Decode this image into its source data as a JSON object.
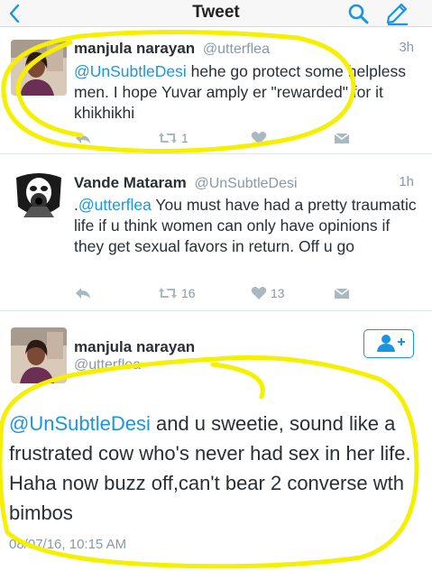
{
  "nav": {
    "title": "Tweet"
  },
  "tweets": [
    {
      "name": "manjula narayan",
      "handle": "@utterflea",
      "time": "3h",
      "mention": "@UnSubtleDesi",
      "text": " hehe go protect some helpless men. I hope Yuvar amply er \"rewarded\" for it khikhikhi",
      "retweets": "1",
      "likes": ""
    },
    {
      "name": "Vande Mataram",
      "handle": "@UnSubtleDesi",
      "time": "1h",
      "prefix": ".",
      "mention": "@utterflea",
      "text": " You must have had a pretty traumatic life if u think women can only have opinions if they get sexual favors in return. Off u go",
      "retweets": "16",
      "likes": "13"
    },
    {
      "name": "manjula narayan",
      "handle": "@utterflea",
      "mention": "@UnSubtleDesi",
      "text": " and u sweetie, sound like a frustrated cow who's never had sex in her life. Haha now buzz off,can't bear 2 converse wth bimbos",
      "timestamp": "08/07/16, 10:15 AM"
    }
  ],
  "colors": {
    "accent": "#1b95e0",
    "muted": "#8899a6",
    "text": "#292f33",
    "highlight": "#f4f000"
  }
}
